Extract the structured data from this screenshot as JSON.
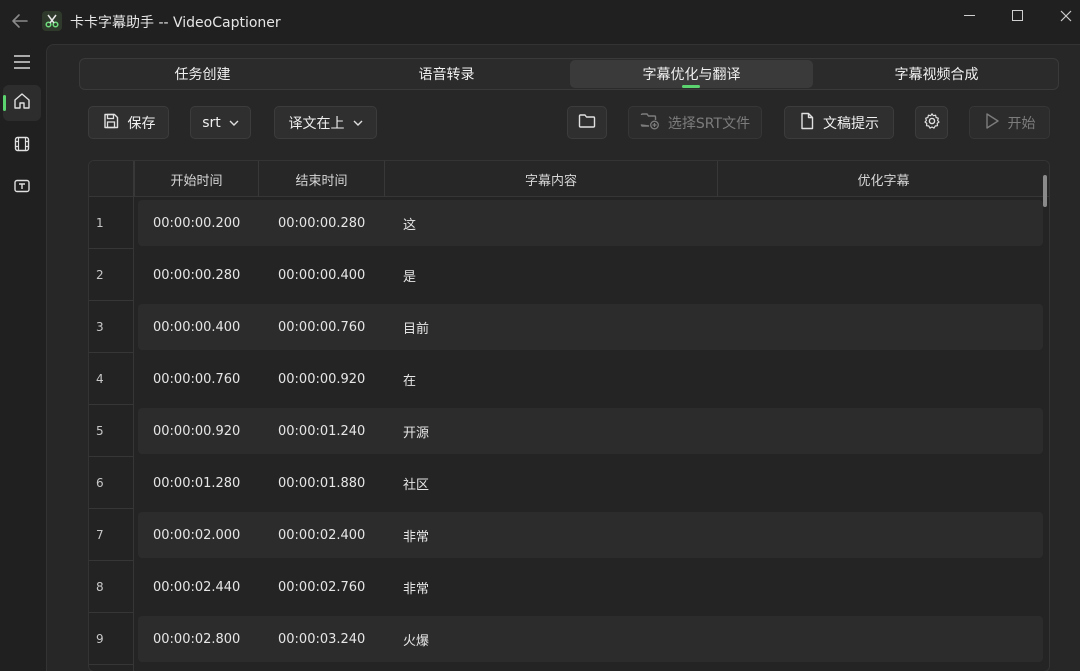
{
  "window": {
    "title": "卡卡字幕助手 -- VideoCaptioner",
    "back_icon": "arrow-left-icon",
    "logo_icon": "scissors-icon",
    "controls": [
      "minimize-icon",
      "maximize-icon",
      "close-icon"
    ]
  },
  "sidebar": {
    "items": [
      {
        "icon": "menu-icon"
      },
      {
        "icon": "home-icon",
        "active": true
      },
      {
        "icon": "film-icon"
      },
      {
        "icon": "text-box-icon"
      }
    ]
  },
  "tabs": [
    {
      "label": "任务创建",
      "active": false
    },
    {
      "label": "语音转录",
      "active": false
    },
    {
      "label": "字幕优化与翻译",
      "active": true
    },
    {
      "label": "字幕视频合成",
      "active": false
    }
  ],
  "toolbar": {
    "save_label": "保存",
    "format_value": "srt",
    "layout_value": "译文在上",
    "select_srt_label": "选择SRT文件",
    "prompt_label": "文稿提示",
    "start_label": "开始"
  },
  "table": {
    "columns": [
      "开始时间",
      "结束时间",
      "字幕内容",
      "优化字幕"
    ],
    "rows": [
      {
        "index": "1",
        "start": "00:00:00.200",
        "end": "00:00:00.280",
        "text": "这",
        "optimized": ""
      },
      {
        "index": "2",
        "start": "00:00:00.280",
        "end": "00:00:00.400",
        "text": "是",
        "optimized": ""
      },
      {
        "index": "3",
        "start": "00:00:00.400",
        "end": "00:00:00.760",
        "text": "目前",
        "optimized": ""
      },
      {
        "index": "4",
        "start": "00:00:00.760",
        "end": "00:00:00.920",
        "text": "在",
        "optimized": ""
      },
      {
        "index": "5",
        "start": "00:00:00.920",
        "end": "00:00:01.240",
        "text": "开源",
        "optimized": ""
      },
      {
        "index": "6",
        "start": "00:00:01.280",
        "end": "00:00:01.880",
        "text": "社区",
        "optimized": ""
      },
      {
        "index": "7",
        "start": "00:00:02.000",
        "end": "00:00:02.400",
        "text": "非常",
        "optimized": ""
      },
      {
        "index": "8",
        "start": "00:00:02.440",
        "end": "00:00:02.760",
        "text": "非常",
        "optimized": ""
      },
      {
        "index": "9",
        "start": "00:00:02.800",
        "end": "00:00:03.240",
        "text": "火爆",
        "optimized": ""
      }
    ]
  },
  "colors": {
    "accent": "#5bd36f",
    "background": "#1f1f1f",
    "panel": "#272727"
  }
}
